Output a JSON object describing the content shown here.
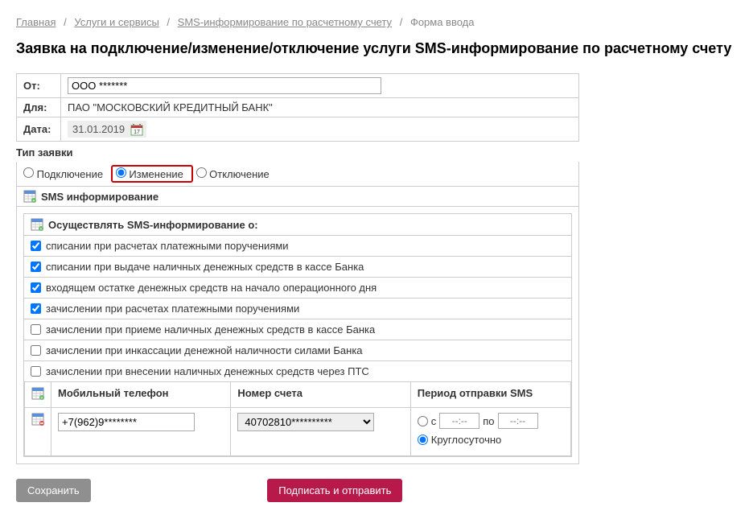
{
  "breadcrumb": {
    "home": "Главная",
    "services": "Услуги и сервисы",
    "sms": "SMS-информирование по расчетному счету",
    "form": "Форма ввода"
  },
  "title": "Заявка на подключение/изменение/отключение услуги SMS-информирование по расчетному счету",
  "formTop": {
    "fromLabel": "От:",
    "fromValue": "ООО *******",
    "forLabel": "Для:",
    "forValue": "ПАО \"МОСКОВСКИЙ КРЕДИТНЫЙ БАНК\"",
    "dateLabel": "Дата:",
    "dateValue": "31.01.2019"
  },
  "appType": {
    "label": "Тип заявки",
    "opt1": "Подключение",
    "opt2": "Изменение",
    "opt3": "Отключение",
    "selected": "Изменение"
  },
  "smsSection": {
    "header": "SMS информирование",
    "subHeader": "Осуществлять SMS-информирование о:",
    "rows": [
      {
        "label": "списании при расчетах платежными поручениями",
        "checked": true
      },
      {
        "label": "списании при выдаче наличных денежных средств в кассе Банка",
        "checked": true
      },
      {
        "label": "входящем остатке денежных средств на начало операционного дня",
        "checked": true
      },
      {
        "label": "зачислении при расчетах платежными поручениями",
        "checked": true
      },
      {
        "label": "зачислении при приеме наличных денежных средств в кассе Банка",
        "checked": false
      },
      {
        "label": "зачислении при инкассации денежной наличности силами Банка",
        "checked": false
      },
      {
        "label": "зачислении при внесении наличных денежных средств через ПТС",
        "checked": false
      }
    ]
  },
  "phoneTable": {
    "col1": "Мобильный телефон",
    "col2": "Номер счета",
    "col3": "Период отправки SMS",
    "phone": "+7(962)9********",
    "account": "40702810**********",
    "periodFromLabel": "с",
    "periodToLabel": "по",
    "timePlaceholder": "--:--",
    "roundClock": "Круглосуточно"
  },
  "buttons": {
    "save": "Сохранить",
    "submit": "Подписать и отправить"
  }
}
